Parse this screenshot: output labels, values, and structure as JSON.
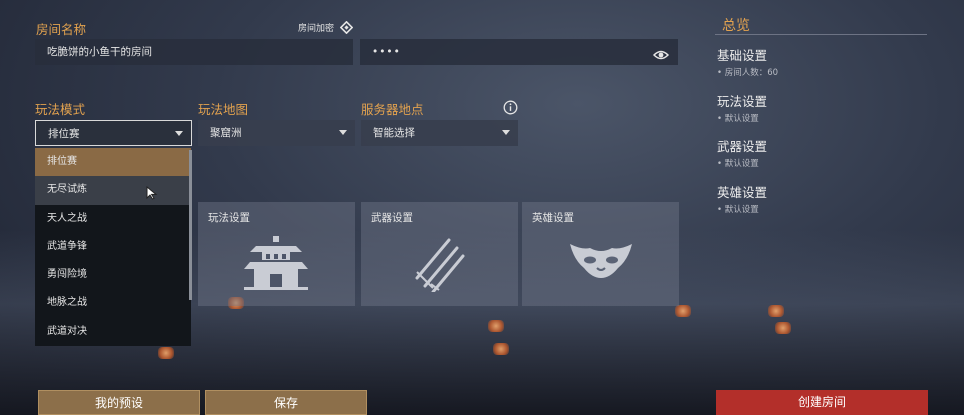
{
  "room": {
    "name_label": "房间名称",
    "name_value": "吃脆饼的小鱼干的房间",
    "password_label": "房间加密",
    "password_value": "••••"
  },
  "filters": {
    "mode_label": "玩法模式",
    "mode_value": "排位赛",
    "map_label": "玩法地图",
    "map_value": "聚窟洲",
    "server_label": "服务器地点",
    "server_value": "智能选择"
  },
  "mode_options": [
    "排位赛",
    "无尽试炼",
    "天人之战",
    "武道争锋",
    "勇闯险境",
    "地脉之战",
    "武道对决"
  ],
  "cards": {
    "gameplay": "玩法设置",
    "weapon": "武器设置",
    "hero": "英雄设置"
  },
  "summary": {
    "title": "总览",
    "basic_title": "基础设置",
    "basic_value": "• 房间人数：60",
    "gameplay_title": "玩法设置",
    "gameplay_value": "• 默认设置",
    "weapon_title": "武器设置",
    "weapon_value": "• 默认设置",
    "hero_title": "英雄设置",
    "hero_value": "• 默认设置"
  },
  "buttons": {
    "presets": "我的预设",
    "save": "保存",
    "create": "创建房间"
  },
  "colors": {
    "accent_gold": "#e2a24f",
    "create_red": "#b32f2a",
    "button_gold": "#8c6f4a"
  }
}
